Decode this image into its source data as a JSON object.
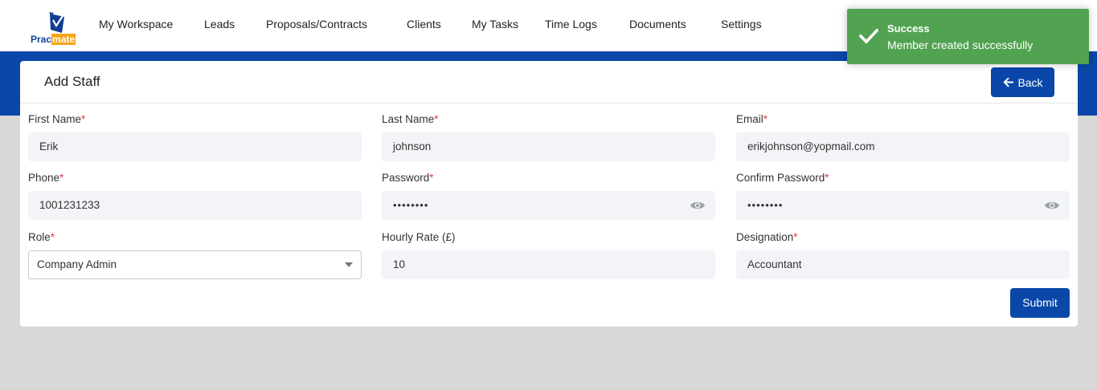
{
  "brand": {
    "logo_part1": "Prac",
    "logo_part2": "mate",
    "primary_color": "#0a47a8",
    "accent_color": "#f5a51b"
  },
  "nav": {
    "items": [
      {
        "label": "My Workspace"
      },
      {
        "label": "Leads"
      },
      {
        "label": "Proposals/Contracts"
      },
      {
        "label": "Clients"
      },
      {
        "label": "My Tasks"
      },
      {
        "label": "Time Logs"
      },
      {
        "label": "Documents"
      },
      {
        "label": "Settings"
      }
    ]
  },
  "page": {
    "title": "Add Staff",
    "back_label": "Back",
    "submit_label": "Submit",
    "required_mark": "*"
  },
  "form": {
    "first_name": {
      "label": "First Name",
      "value": "Erik"
    },
    "last_name": {
      "label": "Last Name",
      "value": "johnson"
    },
    "email": {
      "label": "Email",
      "value": "erikjohnson@yopmail.com"
    },
    "phone": {
      "label": "Phone",
      "value": "1001231233"
    },
    "password": {
      "label": "Password",
      "value": "••••••••"
    },
    "confirm_password": {
      "label": "Confirm Password",
      "value": "••••••••"
    },
    "role": {
      "label": "Role",
      "value": "Company Admin"
    },
    "hourly_rate": {
      "label": "Hourly Rate (£)",
      "value": "10"
    },
    "designation": {
      "label": "Designation",
      "value": "Accountant"
    }
  },
  "toast": {
    "title": "Success",
    "message": "Member created successfully",
    "color": "#51a351"
  }
}
